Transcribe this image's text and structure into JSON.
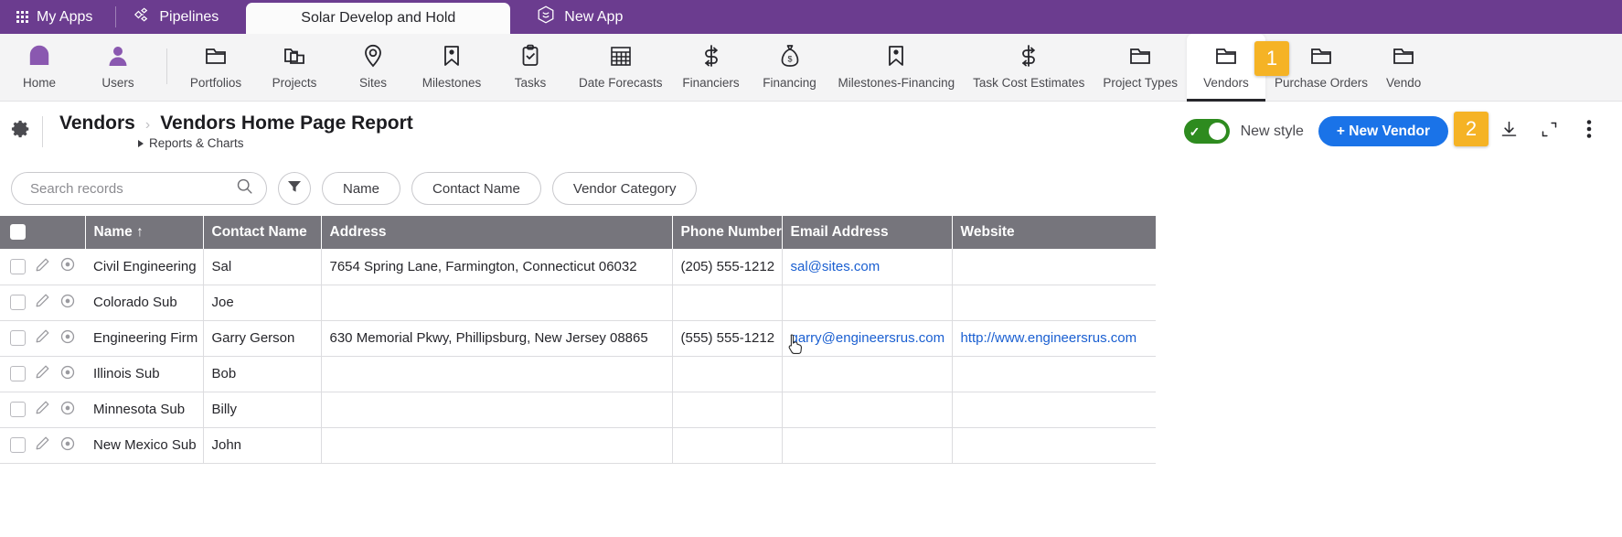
{
  "appbar": {
    "my_apps": "My Apps",
    "pipelines": "Pipelines",
    "active_tab": "Solar Develop and Hold",
    "new_app": "New App"
  },
  "modnav": {
    "items": [
      {
        "label": "Home",
        "icon": "home-icon"
      },
      {
        "label": "Users",
        "icon": "user-icon"
      },
      {
        "label": "Portfolios",
        "icon": "folder-icon"
      },
      {
        "label": "Projects",
        "icon": "folders-icon"
      },
      {
        "label": "Sites",
        "icon": "map-pin-icon"
      },
      {
        "label": "Milestones",
        "icon": "milestone-icon"
      },
      {
        "label": "Tasks",
        "icon": "clipboard-check-icon"
      },
      {
        "label": "Date Forecasts",
        "icon": "calendar-grid-icon"
      },
      {
        "label": "Financiers",
        "icon": "dollar-exchange-icon"
      },
      {
        "label": "Financing",
        "icon": "money-bag-icon"
      },
      {
        "label": "Milestones-Financing",
        "icon": "milestone-icon"
      },
      {
        "label": "Task Cost Estimates",
        "icon": "dollar-exchange-icon"
      },
      {
        "label": "Project Types",
        "icon": "folder-icon"
      },
      {
        "label": "Vendors",
        "icon": "folder-icon"
      },
      {
        "label": "Purchase Orders",
        "icon": "folder-icon"
      },
      {
        "label": "Vendo",
        "icon": "folder-icon"
      }
    ],
    "selected": "Vendors",
    "badge_1": "1"
  },
  "report_header": {
    "app_name": "Vendors",
    "separator": "›",
    "report_name": "Vendors Home Page Report",
    "breadcrumb_sub": "Reports & Charts",
    "new_style_label": "New style",
    "new_style_on": true,
    "new_vendor_button": "+ New Vendor",
    "badge_2": "2",
    "gear_icon": "gear-icon",
    "download_icon": "download-icon",
    "expand_icon": "expand-icon",
    "more_icon": "more-vertical-icon"
  },
  "filterbar": {
    "search_placeholder": "Search records",
    "search_value": "",
    "search_icon": "search-icon",
    "filter_icon": "filter-icon",
    "chips": [
      "Name",
      "Contact Name",
      "Vendor Category"
    ]
  },
  "table": {
    "columns": [
      {
        "key": "tools",
        "label": ""
      },
      {
        "key": "name",
        "label": "Name ↑"
      },
      {
        "key": "contact",
        "label": "Contact Name"
      },
      {
        "key": "address",
        "label": "Address"
      },
      {
        "key": "phone",
        "label": "Phone Number"
      },
      {
        "key": "email",
        "label": "Email Address"
      },
      {
        "key": "website",
        "label": "Website"
      }
    ],
    "rows": [
      {
        "name": "Civil Engineering",
        "contact": "Sal",
        "address": "7654 Spring Lane, Farmington, Connecticut 06032",
        "phone": "(205) 555-1212",
        "email": "sal@sites.com",
        "website": ""
      },
      {
        "name": "Colorado Sub",
        "contact": "Joe",
        "address": "",
        "phone": "",
        "email": "",
        "website": ""
      },
      {
        "name": "Engineering Firm",
        "contact": "Garry Gerson",
        "address": "630 Memorial Pkwy, Phillipsburg, New Jersey 08865",
        "phone": "(555) 555-1212",
        "email": "garry@engineersrus.com",
        "website": "http://www.engineersrus.com"
      },
      {
        "name": "Illinois Sub",
        "contact": "Bob",
        "address": "",
        "phone": "",
        "email": "",
        "website": ""
      },
      {
        "name": "Minnesota Sub",
        "contact": "Billy",
        "address": "",
        "phone": "",
        "email": "",
        "website": ""
      },
      {
        "name": "New Mexico Sub",
        "contact": "John",
        "address": "",
        "phone": "",
        "email": "",
        "website": ""
      }
    ]
  },
  "colors": {
    "brand_purple": "#6b3c8f",
    "badge_orange": "#f5b325",
    "primary_blue": "#1a73e8",
    "toggle_green": "#2e8b1f",
    "table_header_gray": "#76757c",
    "link_blue": "#1a5fd1"
  }
}
